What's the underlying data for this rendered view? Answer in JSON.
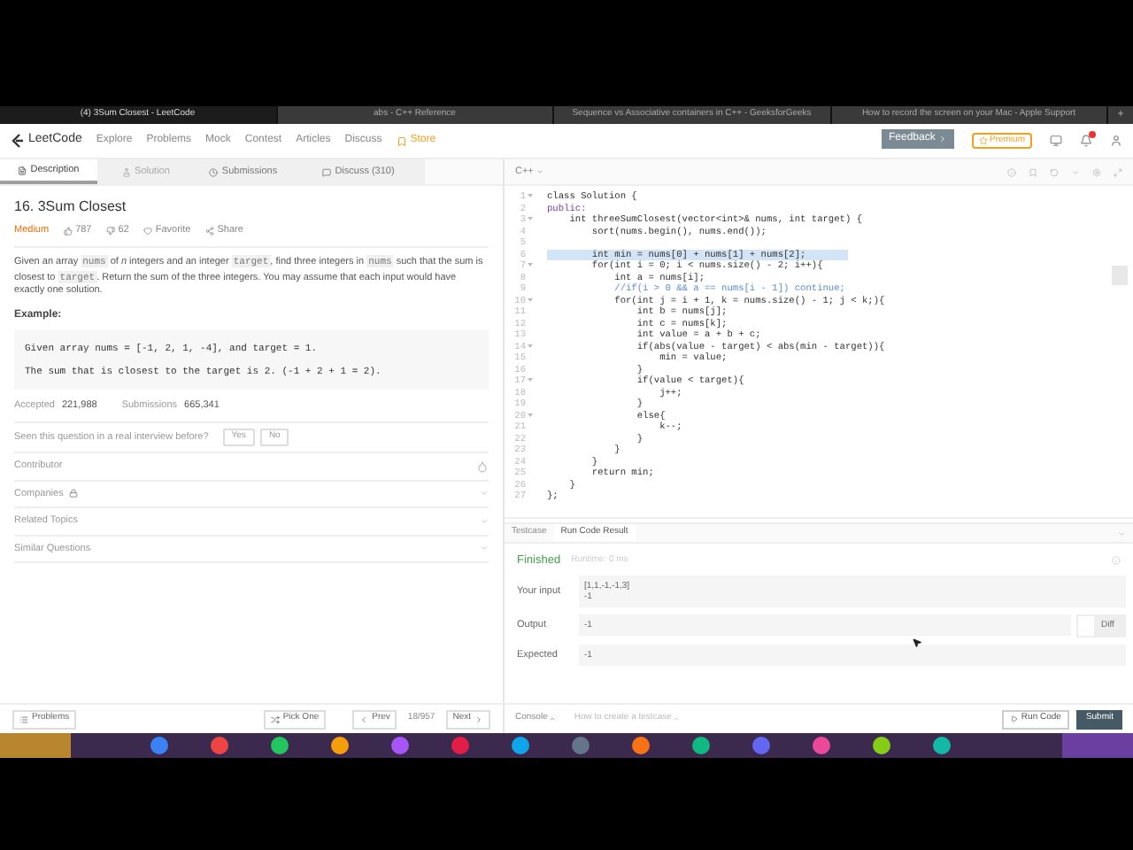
{
  "browser_tabs": [
    {
      "label": "(4) 3Sum Closest - LeetCode",
      "selected": true
    },
    {
      "label": "abs - C++ Reference",
      "selected": false
    },
    {
      "label": "Sequence vs Associative containers in C++ - GeeksforGeeks",
      "selected": false
    },
    {
      "label": "How to record the screen on your Mac - Apple Support",
      "selected": false
    }
  ],
  "new_tab": "+",
  "header": {
    "logo": "LeetCode",
    "nav": [
      {
        "label": "Explore",
        "kind": "link"
      },
      {
        "label": "Problems",
        "kind": "link"
      },
      {
        "label": "Mock",
        "kind": "link"
      },
      {
        "label": "Contest",
        "kind": "link"
      },
      {
        "label": "Articles",
        "kind": "link"
      },
      {
        "label": "Discuss",
        "kind": "link"
      },
      {
        "label": "Store",
        "kind": "store"
      }
    ],
    "feedback": "Feedback",
    "premium": "Premium"
  },
  "tabs": [
    {
      "label": "Description",
      "selected": true,
      "disabled": false
    },
    {
      "label": "Solution",
      "selected": false,
      "disabled": true
    },
    {
      "label": "Submissions",
      "selected": false,
      "disabled": false
    },
    {
      "label": "Discuss (310)",
      "selected": false,
      "disabled": false
    }
  ],
  "problem": {
    "title": "16. 3Sum Closest",
    "difficulty": "Medium",
    "likes": "787",
    "dislikes": "62",
    "favorite": "Favorite",
    "share": "Share",
    "description": [
      {
        "kind": "text",
        "text": "Given an array "
      },
      {
        "kind": "code",
        "text": "nums"
      },
      {
        "kind": "text",
        "text": " of "
      },
      {
        "kind": "italic",
        "text": "n"
      },
      {
        "kind": "text",
        "text": " integers and an integer "
      },
      {
        "kind": "code",
        "text": "target"
      },
      {
        "kind": "text",
        "text": ", find three integers in "
      },
      {
        "kind": "code",
        "text": "nums"
      },
      {
        "kind": "text",
        "text": " such that the sum is closest to "
      },
      {
        "kind": "code",
        "text": "target"
      },
      {
        "kind": "text",
        "text": ". Return the sum of the three integers. You may assume that each input would have exactly one solution."
      }
    ],
    "example_heading": "Example:",
    "example": [
      "Given array nums = [-1, 2, 1, -4], and target = 1.",
      "The sum that is closest to the target is 2. (-1 + 2 + 1 = 2)."
    ],
    "accepted_label": "Accepted",
    "accepted": "221,988",
    "submissions_label": "Submissions",
    "submissions": "665,341",
    "interview_question": "Seen this question in a real interview before?",
    "answers": [
      "Yes",
      "No"
    ],
    "sections": [
      {
        "label": "Contributor",
        "kind": "contributor"
      },
      {
        "label": "Companies",
        "kind": "locked"
      },
      {
        "label": "Related Topics",
        "kind": "expand"
      },
      {
        "label": "Similar Questions",
        "kind": "expand"
      }
    ]
  },
  "footer_left": {
    "problems": "Problems",
    "pick_one": "Pick One",
    "prev": "Prev",
    "position": "18/957",
    "next": "Next"
  },
  "editor": {
    "language": "C++",
    "lines": [
      {
        "number": "1",
        "fold": true,
        "kind": "code",
        "highlighted": false,
        "text": "class Solution {"
      },
      {
        "number": "2",
        "fold": false,
        "kind": "keyword",
        "highlighted": false,
        "text": "public:"
      },
      {
        "number": "3",
        "fold": true,
        "kind": "code",
        "highlighted": false,
        "text": "    int threeSumClosest(vector<int>& nums, int target) {"
      },
      {
        "number": "4",
        "fold": false,
        "kind": "code",
        "highlighted": false,
        "text": "        sort(nums.begin(), nums.end());"
      },
      {
        "number": "5",
        "fold": false,
        "kind": "code",
        "highlighted": false
      },
      {
        "number": "6",
        "fold": false,
        "kind": "code",
        "highlighted": true,
        "text": "        int min = nums[0] + nums[1] + nums[2];"
      },
      {
        "number": "7",
        "fold": true,
        "kind": "code",
        "highlighted": false,
        "text": "        for(int i = 0; i < nums.size() - 2; i++){"
      },
      {
        "number": "8",
        "fold": false,
        "kind": "code",
        "highlighted": false,
        "text": "            int a = nums[i];"
      },
      {
        "number": "9",
        "fold": false,
        "kind": "comment",
        "highlighted": false,
        "text": "            //if(i > 0 && a == nums[i - 1]) continue;"
      },
      {
        "number": "10",
        "fold": true,
        "kind": "code",
        "highlighted": false,
        "text": "            for(int j = i + 1, k = nums.size() - 1; j < k;){"
      },
      {
        "number": "11",
        "fold": false,
        "kind": "code",
        "highlighted": false,
        "text": "                int b = nums[j];"
      },
      {
        "number": "12",
        "fold": false,
        "kind": "code",
        "highlighted": false,
        "text": "                int c = nums[k];"
      },
      {
        "number": "13",
        "fold": false,
        "kind": "code",
        "highlighted": false,
        "text": "                int value = a + b + c;"
      },
      {
        "number": "14",
        "fold": true,
        "kind": "code",
        "highlighted": false,
        "text": "                if(abs(value - target) < abs(min - target)){"
      },
      {
        "number": "15",
        "fold": false,
        "kind": "code",
        "highlighted": false,
        "text": "                    min = value;"
      },
      {
        "number": "16",
        "fold": false,
        "kind": "code",
        "highlighted": false,
        "text": "                }"
      },
      {
        "number": "17",
        "fold": true,
        "kind": "code",
        "highlighted": false,
        "text": "                if(value < target){"
      },
      {
        "number": "18",
        "fold": false,
        "kind": "code",
        "highlighted": false,
        "text": "                    j++;"
      },
      {
        "number": "19",
        "fold": false,
        "kind": "code",
        "highlighted": false,
        "text": "                }"
      },
      {
        "number": "20",
        "fold": true,
        "kind": "code",
        "highlighted": false,
        "text": "                else{"
      },
      {
        "number": "21",
        "fold": false,
        "kind": "code",
        "highlighted": false,
        "text": "                    k--;"
      },
      {
        "number": "22",
        "fold": false,
        "kind": "code",
        "highlighted": false,
        "text": "                }"
      },
      {
        "number": "23",
        "fold": false,
        "kind": "code",
        "highlighted": false,
        "text": "            }"
      },
      {
        "number": "24",
        "fold": false,
        "kind": "code",
        "highlighted": false,
        "text": "        }"
      },
      {
        "number": "25",
        "fold": false,
        "kind": "code",
        "highlighted": false,
        "text": "        return min;"
      },
      {
        "number": "26",
        "fold": false,
        "kind": "code",
        "highlighted": false,
        "text": "    }"
      },
      {
        "number": "27",
        "fold": false,
        "kind": "code",
        "highlighted": false,
        "text": "};"
      }
    ]
  },
  "result_tabs": [
    {
      "label": "Testcase",
      "selected": false
    },
    {
      "label": "Run Code Result",
      "selected": true
    }
  ],
  "result": {
    "status": "Finished",
    "runtime": "Runtime: 0 ms",
    "rows": [
      {
        "label": "Your input",
        "values": [
          "[1,1,-1,-1,3]",
          "-1"
        ],
        "diff": false
      },
      {
        "label": "Output",
        "values": [
          "-1"
        ],
        "diff": true
      },
      {
        "label": "Expected",
        "values": [
          "-1"
        ],
        "diff": false
      }
    ],
    "diff_label": "Diff"
  },
  "footer_right": {
    "console": "Console",
    "testcase_help": "How to create a testcase",
    "run": "Run Code",
    "submit": "Submit"
  }
}
